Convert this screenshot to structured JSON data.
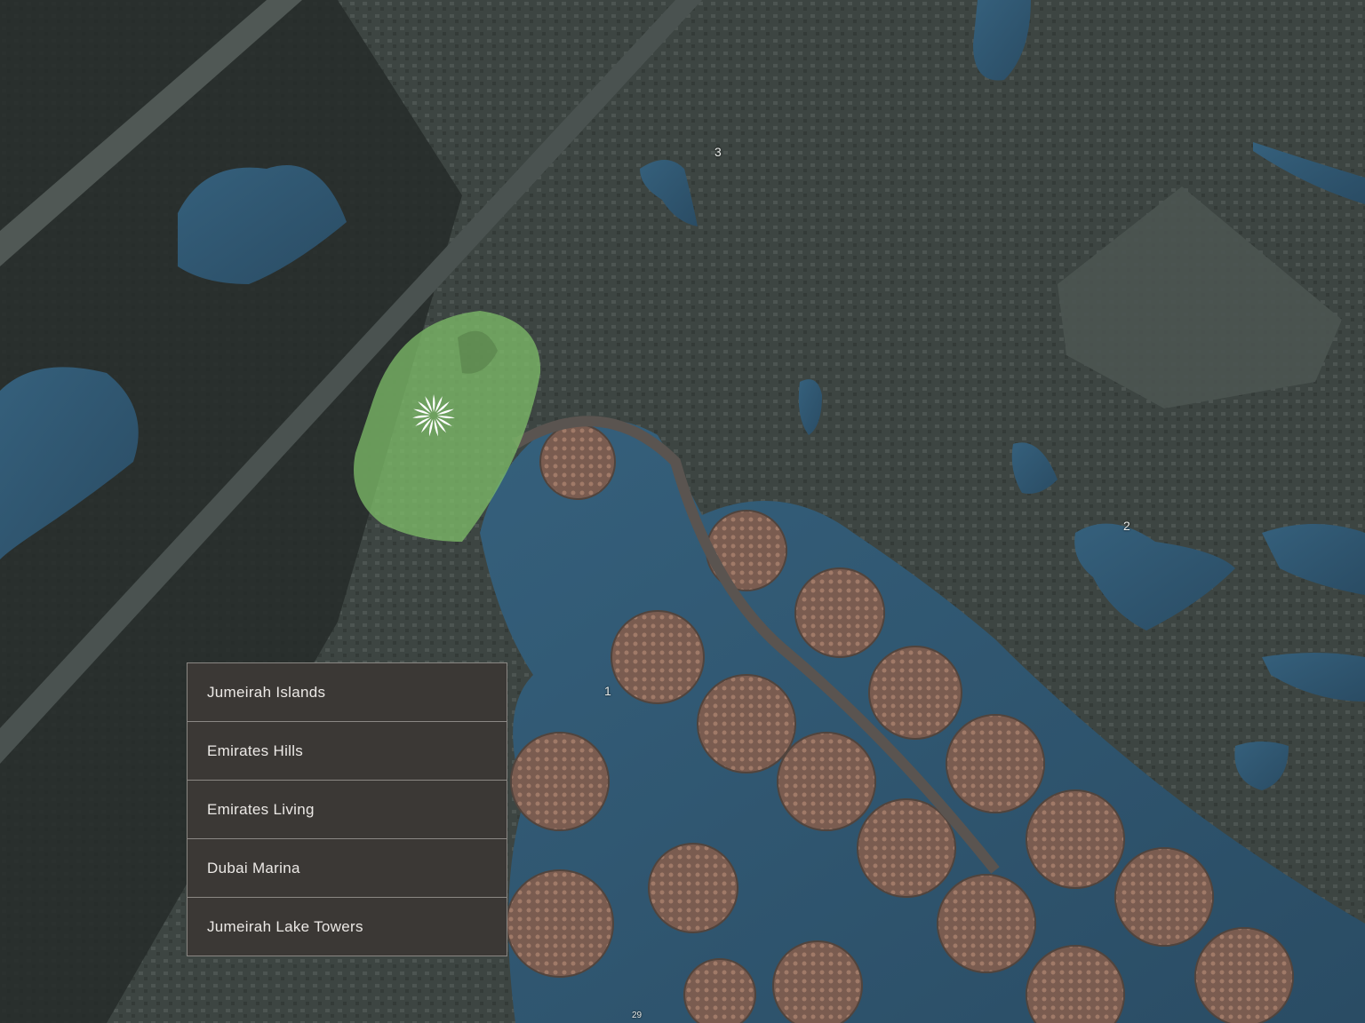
{
  "map": {
    "markers": [
      {
        "id": "1",
        "label": "1"
      },
      {
        "id": "2",
        "label": "2"
      },
      {
        "id": "3",
        "label": "3"
      },
      {
        "id": "29",
        "label": "29"
      }
    ],
    "highlight_area_color": "#7fbf6a",
    "water_color": "#2f5570",
    "logo_icon": "starburst-flower-icon"
  },
  "location_list": {
    "items": [
      {
        "label": "Jumeirah Islands"
      },
      {
        "label": "Emirates Hills"
      },
      {
        "label": "Emirates Living"
      },
      {
        "label": "Dubai Marina"
      },
      {
        "label": "Jumeirah Lake Towers"
      }
    ]
  }
}
